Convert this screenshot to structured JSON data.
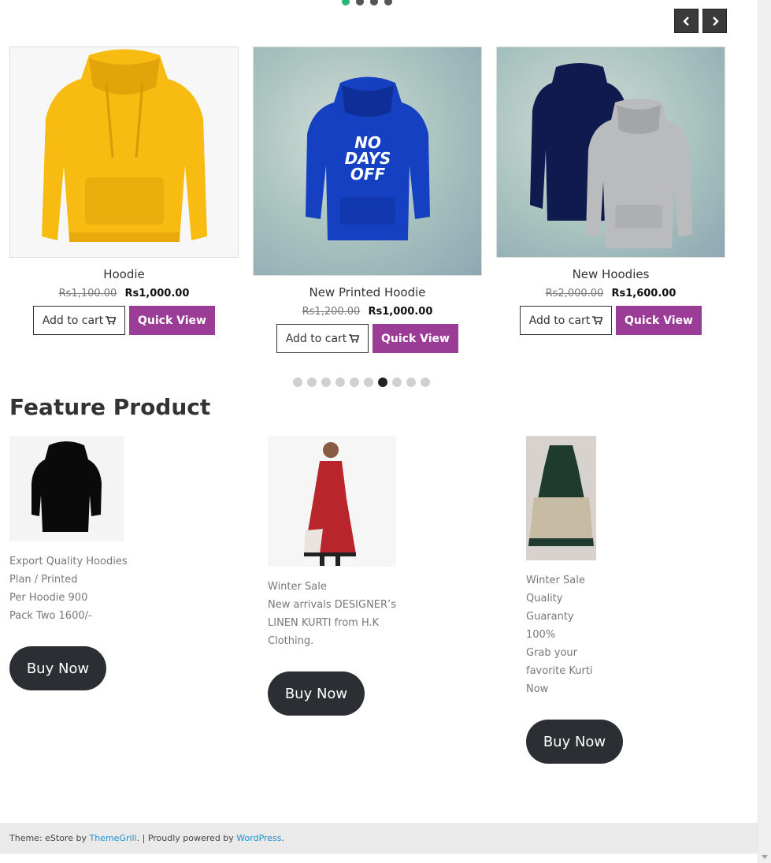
{
  "slider": {
    "top_dots": 4,
    "top_active": 0,
    "prev_label": "‹",
    "next_label": "›"
  },
  "products": [
    {
      "title": "Hoodie",
      "old_price": "Rs1,100.00",
      "price": "Rs1,000.00",
      "cart_label": "Add to cart",
      "quick_view": "Quick View"
    },
    {
      "title": "New Printed Hoodie",
      "old_price": "Rs1,200.00",
      "price": "Rs1,000.00",
      "cart_label": "Add to cart",
      "quick_view": "Quick View"
    },
    {
      "title": "New Hoodies",
      "old_price": "Rs2,000.00",
      "price": "Rs1,600.00",
      "cart_label": "Add to cart",
      "quick_view": "Quick View"
    }
  ],
  "pager": {
    "count": 10,
    "active": 6
  },
  "feature": {
    "title": "Feature Product",
    "items": [
      {
        "lines": [
          "Export Quality Hoodies",
          "Plan / Printed",
          "Per Hoodie 900",
          "Pack Two 1600/-"
        ],
        "button": "Buy Now"
      },
      {
        "lines": [
          "Winter Sale",
          "New arrivals DESIGNER’s",
          "LINEN KURTI from H.K",
          "Clothing."
        ],
        "button": "Buy Now"
      },
      {
        "lines": [
          "Winter Sale",
          "Quality",
          "Guaranty",
          "100%",
          "Grab your",
          "favorite Kurti",
          "Now"
        ],
        "button": "Buy Now"
      }
    ]
  },
  "footer": {
    "prefix": "Theme: eStore by ",
    "themegrill": "ThemeGrill",
    "middle": ". | Proudly powered by ",
    "wordpress": "WordPress",
    "suffix": "."
  },
  "colors": {
    "accent_purple": "#9b3d97",
    "dot_active_green": "#2bb673",
    "buy_button": "#2b2f33",
    "link_blue": "#1e90d0"
  }
}
